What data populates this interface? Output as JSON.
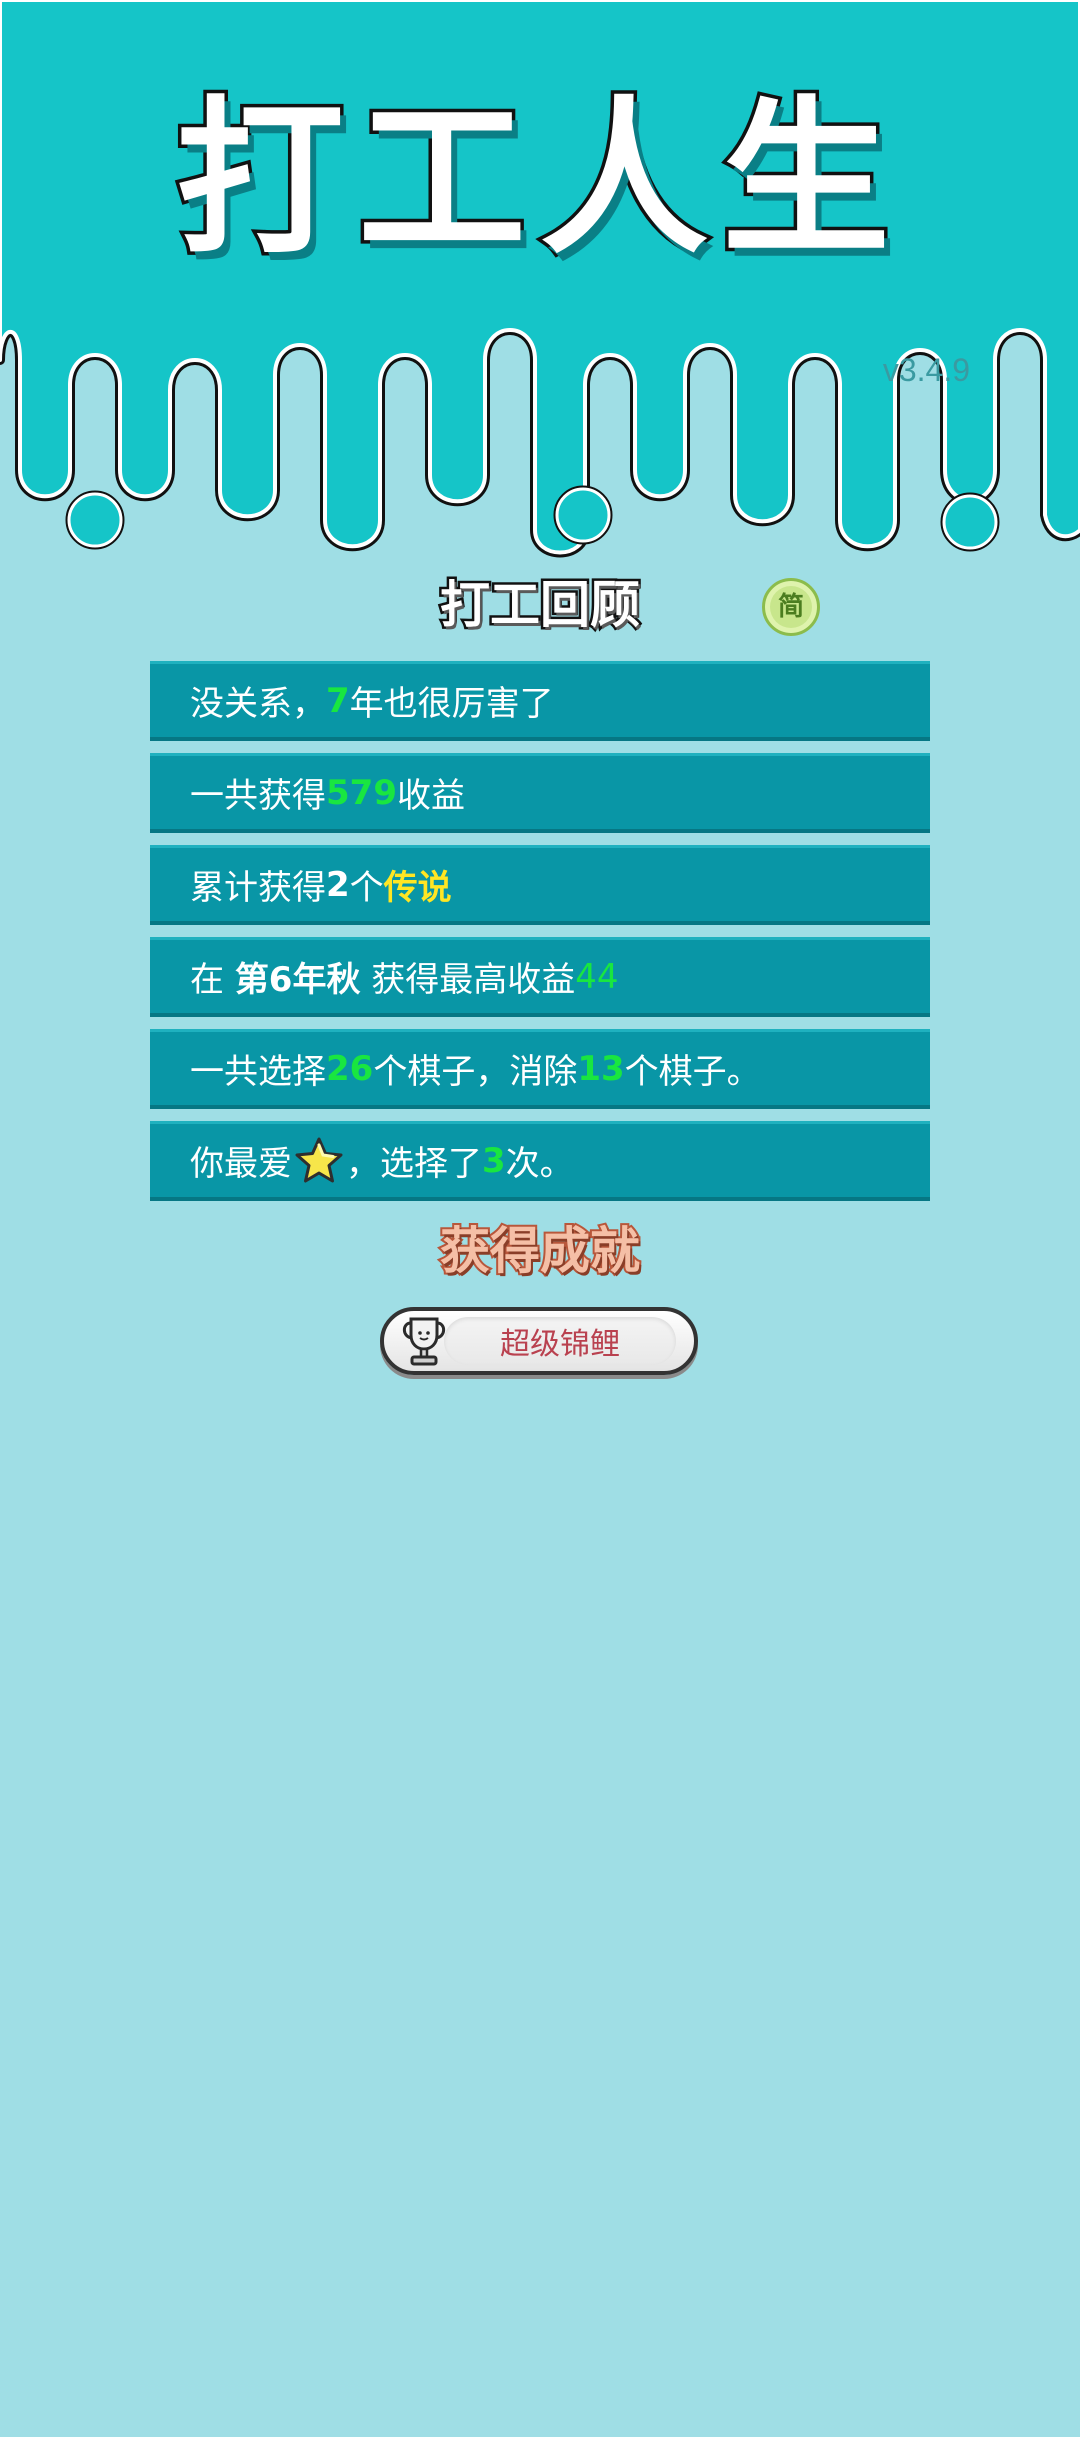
{
  "header": {
    "game_title": "打工人生",
    "version": "v3.4.9"
  },
  "review": {
    "title": "打工回顾",
    "lang_toggle": "简"
  },
  "stats": {
    "line1": {
      "prefix": "没关系，",
      "years": "7",
      "suffix": "年也很厉害了"
    },
    "line2": {
      "prefix": "一共获得",
      "income": "579",
      "suffix": "收益"
    },
    "line3": {
      "prefix": "累计获得",
      "count": "2",
      "mid": "个",
      "legend": "传说"
    },
    "line4": {
      "prefix": "在 ",
      "season": "第6年秋",
      "mid": " 获得最高收益",
      "max_income": "44"
    },
    "line5": {
      "prefix": "一共选择",
      "selected": "26",
      "mid": "个棋子，消除",
      "removed": "13",
      "suffix": "个棋子。"
    },
    "line6": {
      "prefix": "你最爱",
      "favorite_icon": "star-icon",
      "mid": "，选择了",
      "times": "3",
      "suffix": "次。"
    }
  },
  "achievement": {
    "title": "获得成就",
    "badge_icon": "trophy-icon",
    "badge_label": "超级锦鲤"
  },
  "colors": {
    "background": "#9fdee5",
    "header_teal": "#15c5c8",
    "row_bg": "#0996a6",
    "highlight_green": "#19e640",
    "highlight_yellow": "#ffe623"
  }
}
